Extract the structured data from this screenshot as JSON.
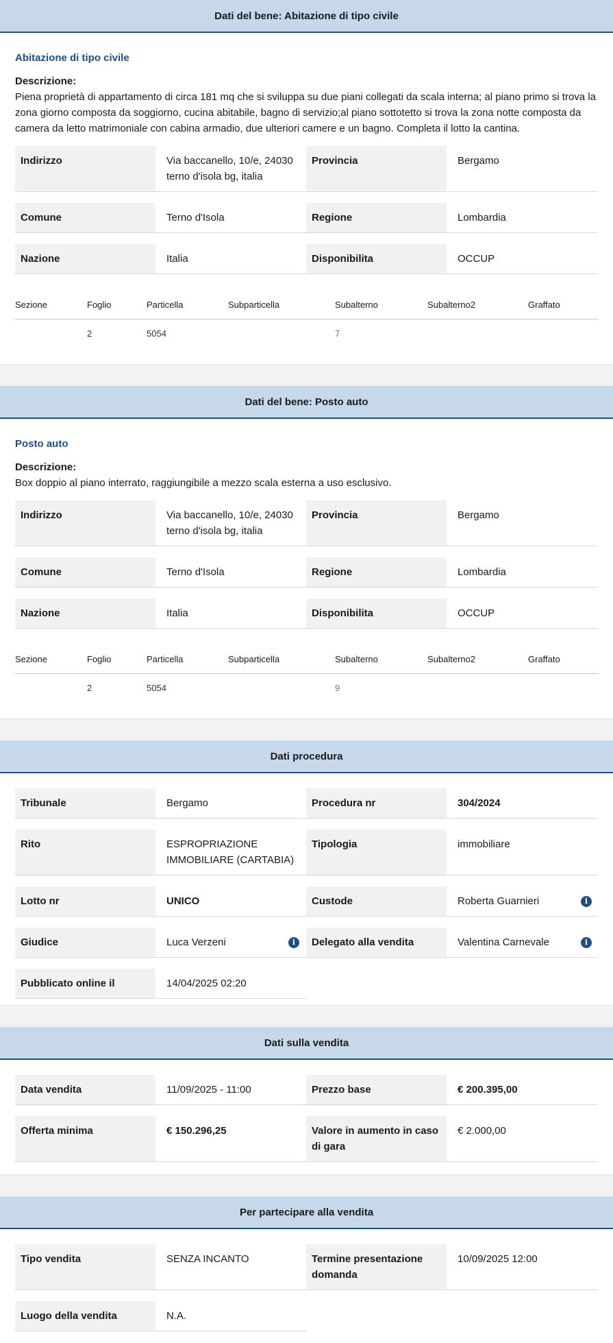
{
  "bene1": {
    "header": "Dati del bene: Abitazione di tipo civile",
    "title": "Abitazione di tipo civile",
    "desc_label": "Descrizione:",
    "desc_text": "Piena proprietà di appartamento di circa 181 mq che si sviluppa su due piani collegati da scala interna; al piano primo si trova la zona giorno composta da soggiorno, cucina abitabile, bagno di servizio;al piano sottotetto si trova la zona notte composta da camera da letto matrimoniale con cabina armadio, due ulteriori camere e un bagno. Completa il lotto la cantina.",
    "indirizzo_label": "Indirizzo",
    "indirizzo_line1": "Via baccanello, 10/e, 24030",
    "indirizzo_line2": "terno d'isola bg, italia",
    "provincia_label": "Provincia",
    "provincia": "Bergamo",
    "comune_label": "Comune",
    "comune": "Terno d'Isola",
    "regione_label": "Regione",
    "regione": "Lombardia",
    "nazione_label": "Nazione",
    "nazione": "Italia",
    "disponibilita_label": "Disponibilita",
    "disponibilita": "OCCUP",
    "catasto_headers": [
      "Sezione",
      "Foglio",
      "Particella",
      "Subparticella",
      "Subalterno",
      "Subalterno2",
      "Graffato"
    ],
    "catasto_row": [
      "",
      "2",
      "5054",
      "",
      "7",
      "",
      ""
    ]
  },
  "bene2": {
    "header": "Dati del bene: Posto auto",
    "title": "Posto auto",
    "desc_label": "Descrizione:",
    "desc_text": "Box doppio al piano interrato, raggiungibile a mezzo scala esterna a uso esclusivo.",
    "indirizzo_label": "Indirizzo",
    "indirizzo_line1": "Via baccanello, 10/e, 24030",
    "indirizzo_line2": "terno d'isola bg, italia",
    "provincia_label": "Provincia",
    "provincia": "Bergamo",
    "comune_label": "Comune",
    "comune": "Terno d'Isola",
    "regione_label": "Regione",
    "regione": "Lombardia",
    "nazione_label": "Nazione",
    "nazione": "Italia",
    "disponibilita_label": "Disponibilita",
    "disponibilita": "OCCUP",
    "catasto_headers": [
      "Sezione",
      "Foglio",
      "Particella",
      "Subparticella",
      "Subalterno",
      "Subalterno2",
      "Graffato"
    ],
    "catasto_row": [
      "",
      "2",
      "5054",
      "",
      "9",
      "",
      ""
    ]
  },
  "procedura": {
    "header": "Dati procedura",
    "tribunale_label": "Tribunale",
    "tribunale": "Bergamo",
    "procedura_nr_label": "Procedura nr",
    "procedura_nr": "304/2024",
    "rito_label": "Rito",
    "rito_line1": "ESPROPRIAZIONE",
    "rito_line2": "IMMOBILIARE (CARTABIA)",
    "tipologia_label": "Tipologia",
    "tipologia": "immobiliare",
    "lotto_label": "Lotto nr",
    "lotto": "UNICO",
    "custode_label": "Custode",
    "custode": "Roberta Guarnieri",
    "giudice_label": "Giudice",
    "giudice": "Luca Verzeni",
    "delegato_label": "Delegato alla vendita",
    "delegato": "Valentina Carnevale",
    "pubblicato_label": "Pubblicato online il",
    "pubblicato": "14/04/2025 02:20"
  },
  "vendita": {
    "header": "Dati sulla vendita",
    "data_label": "Data vendita",
    "data": "11/09/2025 - 11:00",
    "prezzo_label": "Prezzo base",
    "prezzo": "€ 200.395,00",
    "offerta_label": "Offerta minima",
    "offerta": "€ 150.296,25",
    "aumento_label_line1": "Valore in aumento in caso",
    "aumento_label_line2": "di gara",
    "aumento": "€ 2.000,00"
  },
  "partecipare": {
    "header": "Per partecipare alla vendita",
    "tipo_label": "Tipo vendita",
    "tipo": "SENZA INCANTO",
    "termine_label_line1": "Termine presentazione",
    "termine_label_line2": "domanda",
    "termine": "10/09/2025 12:00",
    "luogo_label": "Luogo della vendita",
    "luogo": "N.A."
  },
  "icons": {
    "info": "info-circle-icon"
  },
  "colors": {
    "header_bg": "#c6d8ea",
    "accent": "#1f4f80"
  }
}
